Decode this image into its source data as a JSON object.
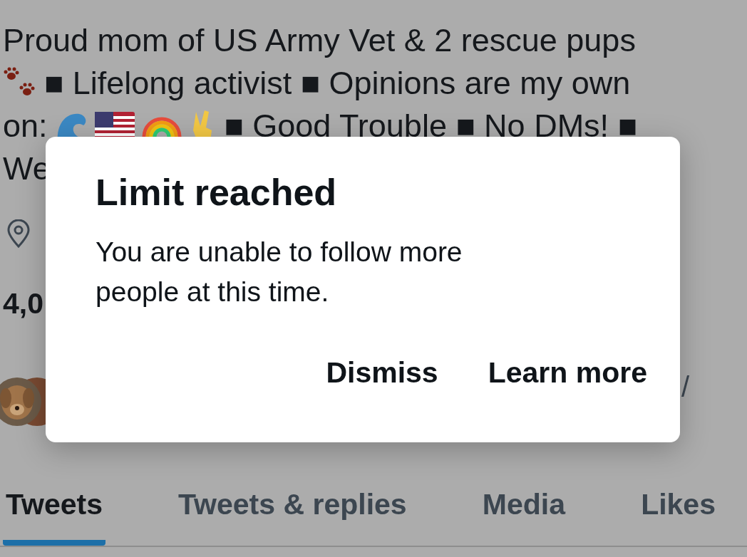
{
  "bio": {
    "line_1": "Proud mom of US Army Vet & 2 rescue pups",
    "line_2": "■ Lifelong activist ■ Opinions are my own",
    "line_3_start": "on:",
    "line_3_end": "■ Good Trouble ■ No DMs! ■",
    "line_4": "We"
  },
  "stats_partial": "4,0",
  "followed_by_partial": "/",
  "dialog": {
    "title": "Limit reached",
    "message": "You are unable to follow more people at this time.",
    "buttons": [
      "Dismiss",
      "Learn more"
    ]
  },
  "tabs": [
    {
      "label": "Tweets",
      "selected": true
    },
    {
      "label": "Tweets & replies",
      "selected": false
    },
    {
      "label": "Media",
      "selected": false
    },
    {
      "label": "Likes",
      "selected": false
    }
  ]
}
